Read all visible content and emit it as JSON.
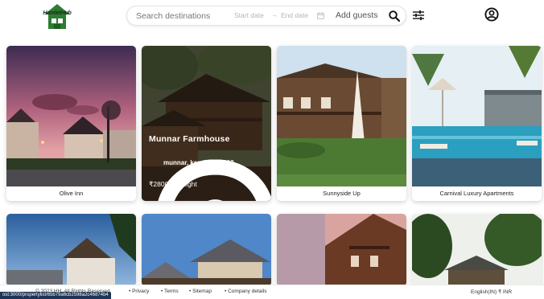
{
  "header": {
    "logo_text": "HamletHub",
    "search": {
      "placeholder": "Search destinations",
      "start_date": "Start date",
      "arrow": "→",
      "end_date": "End date",
      "guests": "Add guests"
    }
  },
  "listings": [
    {
      "name": "Olive Inn"
    },
    {
      "name": "Munnar Farmhouse",
      "location": "munnar, kerala, 685612",
      "price": "₹2800 per night"
    },
    {
      "name": "Sunnyside Up"
    },
    {
      "name": "Carnival Luxury Apartments"
    }
  ],
  "footer": {
    "copyright": "© 2023 HH, All Rights Reserved",
    "links": [
      "Privacy",
      "Terms",
      "Sitemap",
      "Company details"
    ],
    "locale": "English(IN) ₹ INR"
  },
  "status_url": "ost:3000/propertylist/65b79a6cb2598a2c46874b4",
  "icons": {
    "search": "search-icon",
    "calendar": "calendar-icon",
    "filter": "filter-sliders-icon",
    "account": "account-circle-icon",
    "location": "location-pin-icon",
    "logo": "house-logo-icon"
  },
  "colors": {
    "logo_green": "#2e7d32",
    "footer_status_bg": "#1f3557",
    "overlay": "#1e160e"
  }
}
